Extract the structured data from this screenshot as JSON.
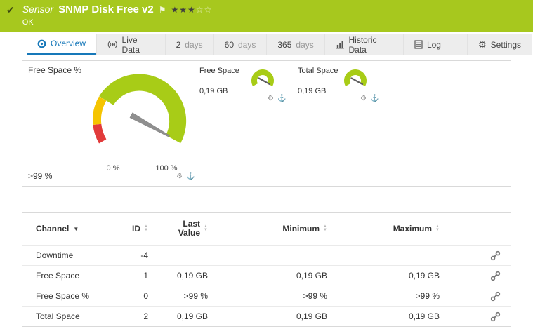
{
  "colors": {
    "header_green": "#a7c81e",
    "accent_blue": "#1778b9",
    "gauge_green": "#a8cc17",
    "gauge_yellow": "#f5c400",
    "gauge_red": "#e23b3b",
    "needle_gray": "#8f8f8f"
  },
  "icons": {
    "check": "✔",
    "flag": "⚑",
    "gear": "⚙",
    "anchor": "⚓",
    "sort_asc": "▲",
    "sort_desc": "▼",
    "caret_down": "▼"
  },
  "header": {
    "kind": "Sensor",
    "title": "SNMP Disk Free v2",
    "status": "OK",
    "rating_filled": "★★★",
    "rating_empty": "☆☆"
  },
  "tabs": [
    {
      "label": "Overview"
    },
    {
      "label": "Live Data"
    },
    {
      "num": "2",
      "unit": "days"
    },
    {
      "num": "60",
      "unit": "days"
    },
    {
      "num": "365",
      "unit": "days"
    },
    {
      "label": "Historic Data"
    },
    {
      "label": "Log"
    },
    {
      "label": "Settings"
    }
  ],
  "gauge_panel": {
    "title": "Free Space %",
    "value": ">99 %",
    "scale_min": "0 %",
    "scale_max": "100 %",
    "mini": [
      {
        "title": "Free Space",
        "value": "0,19 GB"
      },
      {
        "title": "Total Space",
        "value": "0,19 GB"
      }
    ]
  },
  "table": {
    "headers": [
      "Channel",
      "ID",
      "Last Value",
      "Minimum",
      "Maximum"
    ],
    "rows": [
      {
        "channel": "Downtime",
        "id": "-4",
        "last": "",
        "min": "",
        "max": ""
      },
      {
        "channel": "Free Space",
        "id": "1",
        "last": "0,19 GB",
        "min": "0,19 GB",
        "max": "0,19 GB"
      },
      {
        "channel": "Free Space %",
        "id": "0",
        "last": ">99 %",
        "min": ">99 %",
        "max": ">99 %"
      },
      {
        "channel": "Total Space",
        "id": "2",
        "last": "0,19 GB",
        "min": "0,19 GB",
        "max": "0,19 GB"
      }
    ]
  }
}
